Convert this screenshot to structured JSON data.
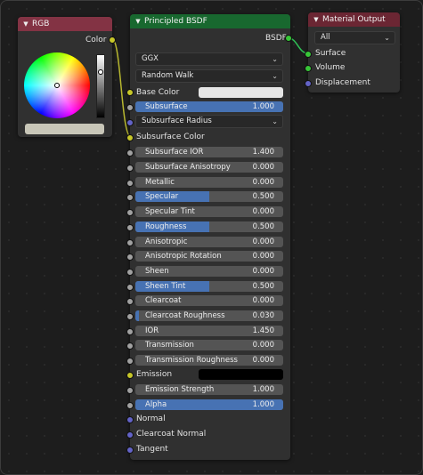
{
  "rgb_node": {
    "title": "RGB",
    "output_label": "Color",
    "header_color": "#833344",
    "swatch_color": "#c8c6b8"
  },
  "bsdf_node": {
    "title": "Principled BSDF",
    "output_label": "BSDF",
    "header_color": "#18682f",
    "distribution": "GGX",
    "subsurface_method": "Random Walk",
    "base_color_label": "Base Color",
    "base_color_value": "#e6e6e6",
    "subsurface_radius_label": "Subsurface Radius",
    "subsurface_color_label": "Subsurface Color",
    "emission_label": "Emission",
    "emission_value": "#000000",
    "normal_label": "Normal",
    "clearcoat_normal_label": "Clearcoat Normal",
    "tangent_label": "Tangent",
    "fields": [
      {
        "label": "Subsurface",
        "value": "1.000",
        "fill": 1.0
      },
      {
        "label": "Subsurface IOR",
        "value": "1.400",
        "fill": 0
      },
      {
        "label": "Subsurface Anisotropy",
        "value": "0.000",
        "fill": 0
      },
      {
        "label": "Metallic",
        "value": "0.000",
        "fill": 0
      },
      {
        "label": "Specular",
        "value": "0.500",
        "fill": 0.5
      },
      {
        "label": "Specular Tint",
        "value": "0.000",
        "fill": 0
      },
      {
        "label": "Roughness",
        "value": "0.500",
        "fill": 0.5
      },
      {
        "label": "Anisotropic",
        "value": "0.000",
        "fill": 0
      },
      {
        "label": "Anisotropic Rotation",
        "value": "0.000",
        "fill": 0
      },
      {
        "label": "Sheen",
        "value": "0.000",
        "fill": 0
      },
      {
        "label": "Sheen Tint",
        "value": "0.500",
        "fill": 0.5
      },
      {
        "label": "Clearcoat",
        "value": "0.000",
        "fill": 0
      },
      {
        "label": "Clearcoat Roughness",
        "value": "0.030",
        "fill": 0.03
      },
      {
        "label": "IOR",
        "value": "1.450",
        "fill": 0
      },
      {
        "label": "Transmission",
        "value": "0.000",
        "fill": 0
      },
      {
        "label": "Transmission Roughness",
        "value": "0.000",
        "fill": 0
      },
      {
        "label": "Emission Strength",
        "value": "1.000",
        "fill": 0
      },
      {
        "label": "Alpha",
        "value": "1.000",
        "fill": 1.0
      }
    ]
  },
  "output_node": {
    "title": "Material Output",
    "header_color": "#6b2633",
    "target": "All",
    "surface_label": "Surface",
    "volume_label": "Volume",
    "displacement_label": "Displacement"
  },
  "colors": {
    "wire": "#b7b72f",
    "shader_wire": "#2fbf55",
    "slider_fill": "#4772b3"
  }
}
